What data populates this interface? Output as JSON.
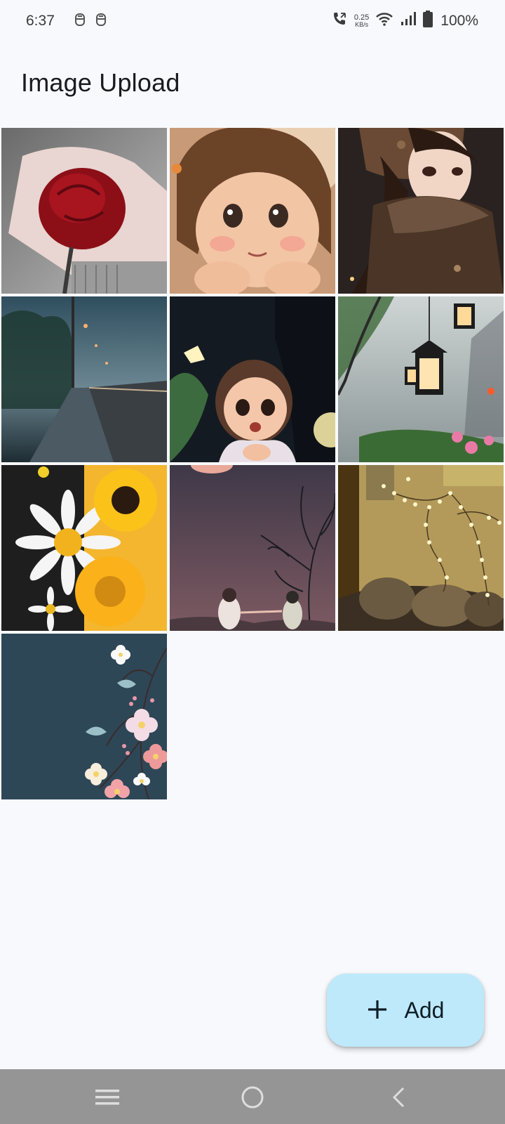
{
  "status_bar": {
    "time": "6:37",
    "network_speed_value": "0.25",
    "network_speed_unit": "KB/s",
    "battery": "100%",
    "left_icons": [
      "notification-icon",
      "notification-icon"
    ],
    "right_icons": [
      "call-icon",
      "wifi-icon",
      "signal-icon",
      "battery-icon"
    ]
  },
  "header": {
    "title": "Image Upload"
  },
  "gallery": {
    "images": [
      {
        "name": "image-red-rose"
      },
      {
        "name": "image-cartoon-girl-smiling"
      },
      {
        "name": "image-anime-girl-scarf"
      },
      {
        "name": "image-foggy-road"
      },
      {
        "name": "image-cartoon-girl-night"
      },
      {
        "name": "image-lanterns"
      },
      {
        "name": "image-daisies-sunflowers"
      },
      {
        "name": "image-couple-moon"
      },
      {
        "name": "image-fairy-lights-room"
      },
      {
        "name": "image-blossom-branch"
      }
    ]
  },
  "fab": {
    "label": "Add",
    "icon": "plus-icon",
    "color": "#bde9fb"
  },
  "nav_bar": {
    "buttons": [
      "menu-icon",
      "home-icon",
      "back-icon"
    ],
    "color": "#959595"
  }
}
